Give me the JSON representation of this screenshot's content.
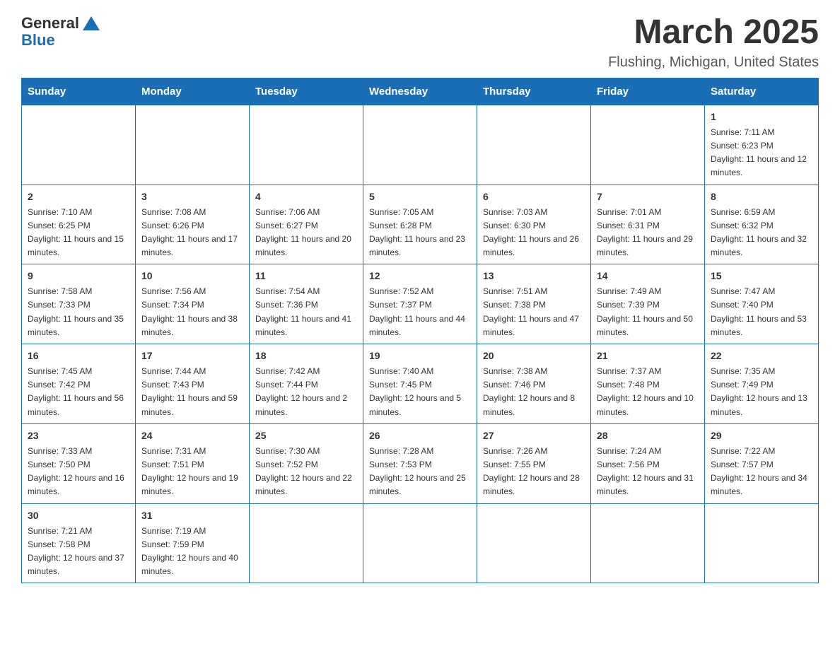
{
  "logo": {
    "general": "General",
    "blue": "Blue"
  },
  "header": {
    "title": "March 2025",
    "location": "Flushing, Michigan, United States"
  },
  "days_of_week": [
    "Sunday",
    "Monday",
    "Tuesday",
    "Wednesday",
    "Thursday",
    "Friday",
    "Saturday"
  ],
  "weeks": [
    [
      {
        "day": "",
        "info": ""
      },
      {
        "day": "",
        "info": ""
      },
      {
        "day": "",
        "info": ""
      },
      {
        "day": "",
        "info": ""
      },
      {
        "day": "",
        "info": ""
      },
      {
        "day": "",
        "info": ""
      },
      {
        "day": "1",
        "info": "Sunrise: 7:11 AM\nSunset: 6:23 PM\nDaylight: 11 hours and 12 minutes."
      }
    ],
    [
      {
        "day": "2",
        "info": "Sunrise: 7:10 AM\nSunset: 6:25 PM\nDaylight: 11 hours and 15 minutes."
      },
      {
        "day": "3",
        "info": "Sunrise: 7:08 AM\nSunset: 6:26 PM\nDaylight: 11 hours and 17 minutes."
      },
      {
        "day": "4",
        "info": "Sunrise: 7:06 AM\nSunset: 6:27 PM\nDaylight: 11 hours and 20 minutes."
      },
      {
        "day": "5",
        "info": "Sunrise: 7:05 AM\nSunset: 6:28 PM\nDaylight: 11 hours and 23 minutes."
      },
      {
        "day": "6",
        "info": "Sunrise: 7:03 AM\nSunset: 6:30 PM\nDaylight: 11 hours and 26 minutes."
      },
      {
        "day": "7",
        "info": "Sunrise: 7:01 AM\nSunset: 6:31 PM\nDaylight: 11 hours and 29 minutes."
      },
      {
        "day": "8",
        "info": "Sunrise: 6:59 AM\nSunset: 6:32 PM\nDaylight: 11 hours and 32 minutes."
      }
    ],
    [
      {
        "day": "9",
        "info": "Sunrise: 7:58 AM\nSunset: 7:33 PM\nDaylight: 11 hours and 35 minutes."
      },
      {
        "day": "10",
        "info": "Sunrise: 7:56 AM\nSunset: 7:34 PM\nDaylight: 11 hours and 38 minutes."
      },
      {
        "day": "11",
        "info": "Sunrise: 7:54 AM\nSunset: 7:36 PM\nDaylight: 11 hours and 41 minutes."
      },
      {
        "day": "12",
        "info": "Sunrise: 7:52 AM\nSunset: 7:37 PM\nDaylight: 11 hours and 44 minutes."
      },
      {
        "day": "13",
        "info": "Sunrise: 7:51 AM\nSunset: 7:38 PM\nDaylight: 11 hours and 47 minutes."
      },
      {
        "day": "14",
        "info": "Sunrise: 7:49 AM\nSunset: 7:39 PM\nDaylight: 11 hours and 50 minutes."
      },
      {
        "day": "15",
        "info": "Sunrise: 7:47 AM\nSunset: 7:40 PM\nDaylight: 11 hours and 53 minutes."
      }
    ],
    [
      {
        "day": "16",
        "info": "Sunrise: 7:45 AM\nSunset: 7:42 PM\nDaylight: 11 hours and 56 minutes."
      },
      {
        "day": "17",
        "info": "Sunrise: 7:44 AM\nSunset: 7:43 PM\nDaylight: 11 hours and 59 minutes."
      },
      {
        "day": "18",
        "info": "Sunrise: 7:42 AM\nSunset: 7:44 PM\nDaylight: 12 hours and 2 minutes."
      },
      {
        "day": "19",
        "info": "Sunrise: 7:40 AM\nSunset: 7:45 PM\nDaylight: 12 hours and 5 minutes."
      },
      {
        "day": "20",
        "info": "Sunrise: 7:38 AM\nSunset: 7:46 PM\nDaylight: 12 hours and 8 minutes."
      },
      {
        "day": "21",
        "info": "Sunrise: 7:37 AM\nSunset: 7:48 PM\nDaylight: 12 hours and 10 minutes."
      },
      {
        "day": "22",
        "info": "Sunrise: 7:35 AM\nSunset: 7:49 PM\nDaylight: 12 hours and 13 minutes."
      }
    ],
    [
      {
        "day": "23",
        "info": "Sunrise: 7:33 AM\nSunset: 7:50 PM\nDaylight: 12 hours and 16 minutes."
      },
      {
        "day": "24",
        "info": "Sunrise: 7:31 AM\nSunset: 7:51 PM\nDaylight: 12 hours and 19 minutes."
      },
      {
        "day": "25",
        "info": "Sunrise: 7:30 AM\nSunset: 7:52 PM\nDaylight: 12 hours and 22 minutes."
      },
      {
        "day": "26",
        "info": "Sunrise: 7:28 AM\nSunset: 7:53 PM\nDaylight: 12 hours and 25 minutes."
      },
      {
        "day": "27",
        "info": "Sunrise: 7:26 AM\nSunset: 7:55 PM\nDaylight: 12 hours and 28 minutes."
      },
      {
        "day": "28",
        "info": "Sunrise: 7:24 AM\nSunset: 7:56 PM\nDaylight: 12 hours and 31 minutes."
      },
      {
        "day": "29",
        "info": "Sunrise: 7:22 AM\nSunset: 7:57 PM\nDaylight: 12 hours and 34 minutes."
      }
    ],
    [
      {
        "day": "30",
        "info": "Sunrise: 7:21 AM\nSunset: 7:58 PM\nDaylight: 12 hours and 37 minutes."
      },
      {
        "day": "31",
        "info": "Sunrise: 7:19 AM\nSunset: 7:59 PM\nDaylight: 12 hours and 40 minutes."
      },
      {
        "day": "",
        "info": ""
      },
      {
        "day": "",
        "info": ""
      },
      {
        "day": "",
        "info": ""
      },
      {
        "day": "",
        "info": ""
      },
      {
        "day": "",
        "info": ""
      }
    ]
  ]
}
